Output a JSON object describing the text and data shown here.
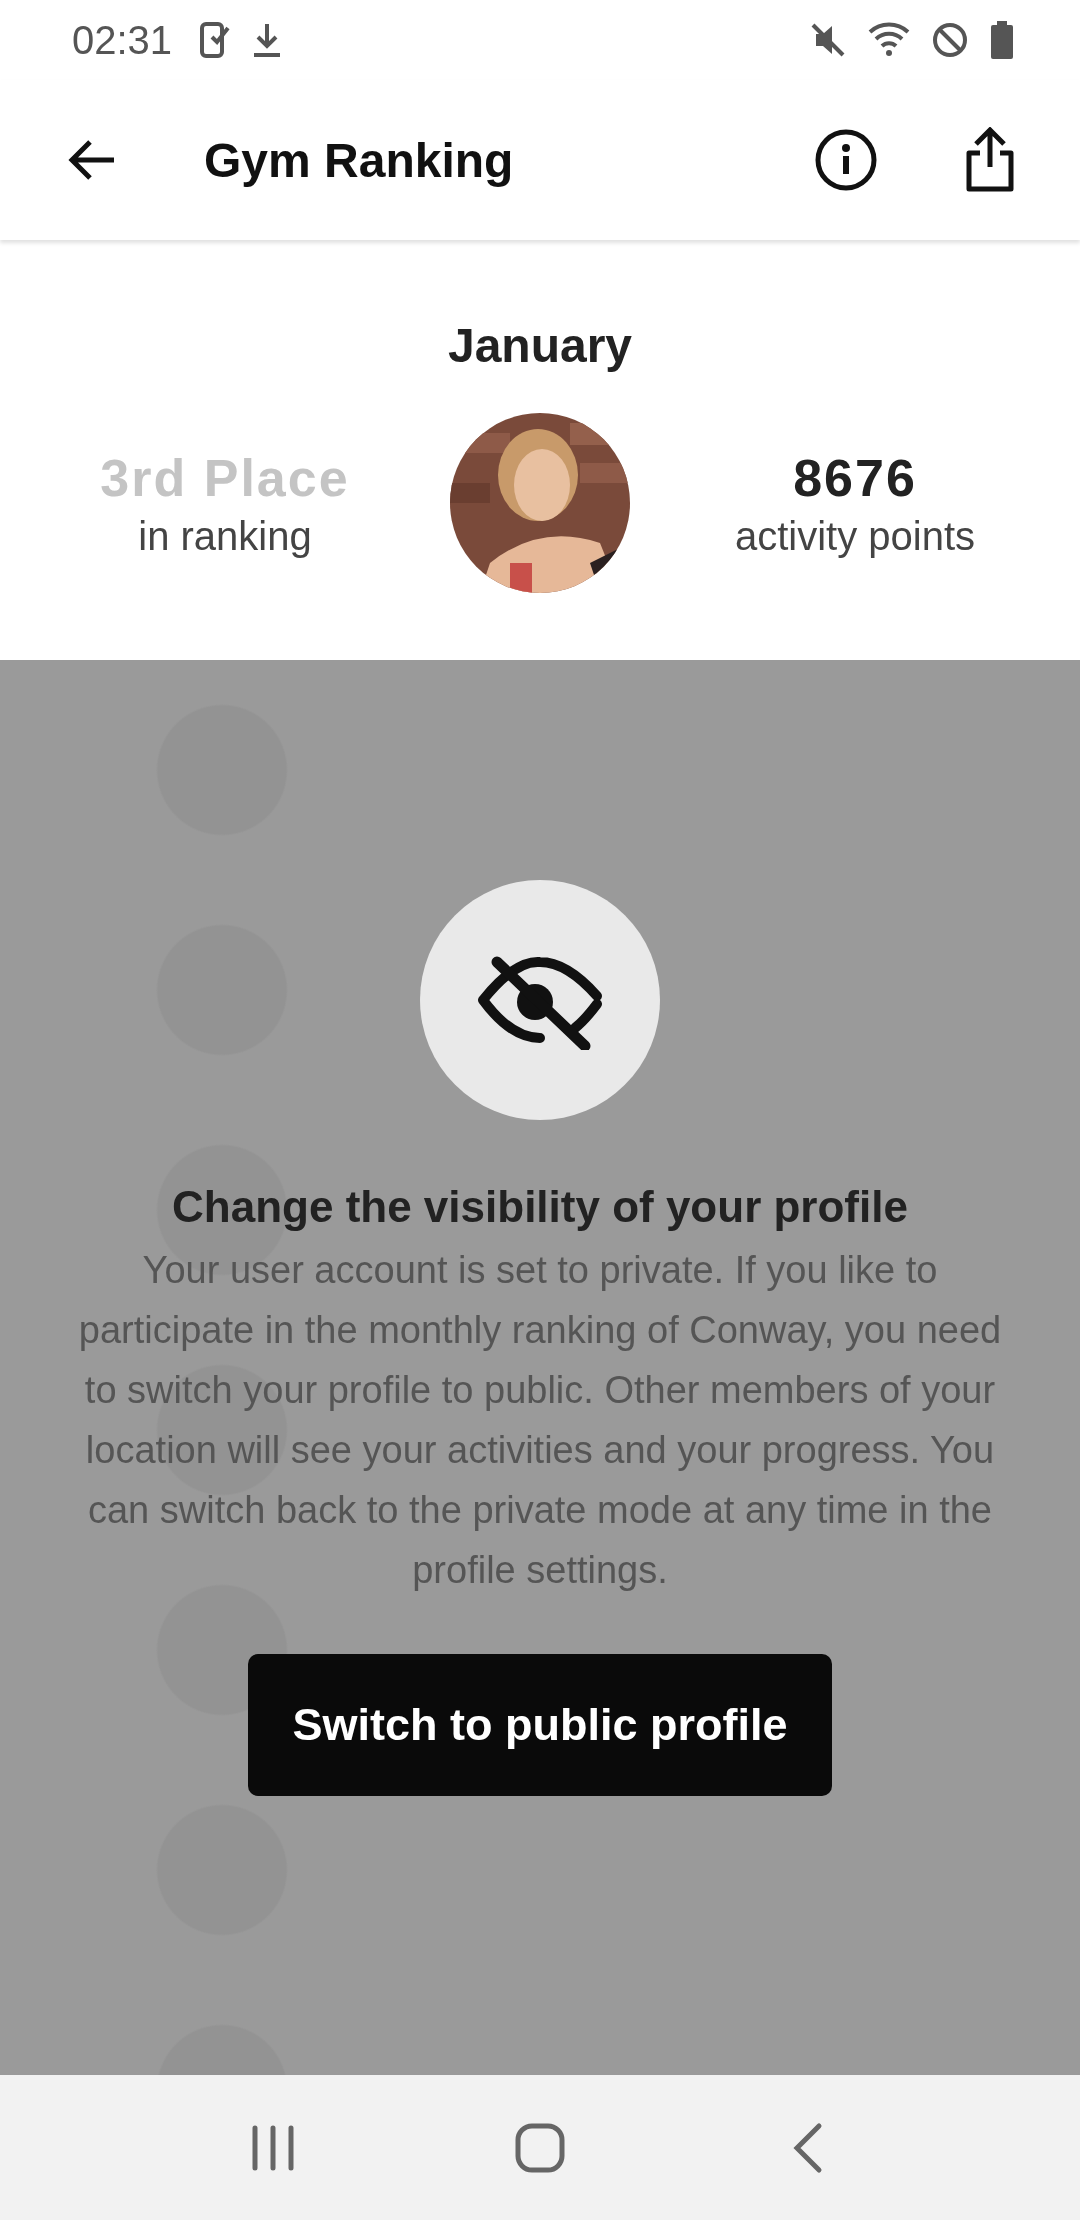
{
  "status_bar": {
    "time": "02:31"
  },
  "app_bar": {
    "title": "Gym Ranking"
  },
  "header": {
    "month": "January",
    "rank": "3rd Place",
    "rank_caption": "in ranking",
    "points": "8676",
    "points_caption": "activity points"
  },
  "dialog": {
    "title": "Change the visibility of your profile",
    "body": "Your user account is set to private. If you like to participate in the monthly ranking of Conway, you need to switch your profile to public. Other members of your location will see your activities and your progress. You can switch back to the private mode at any time in the profile settings.",
    "button": "Switch to public profile"
  }
}
